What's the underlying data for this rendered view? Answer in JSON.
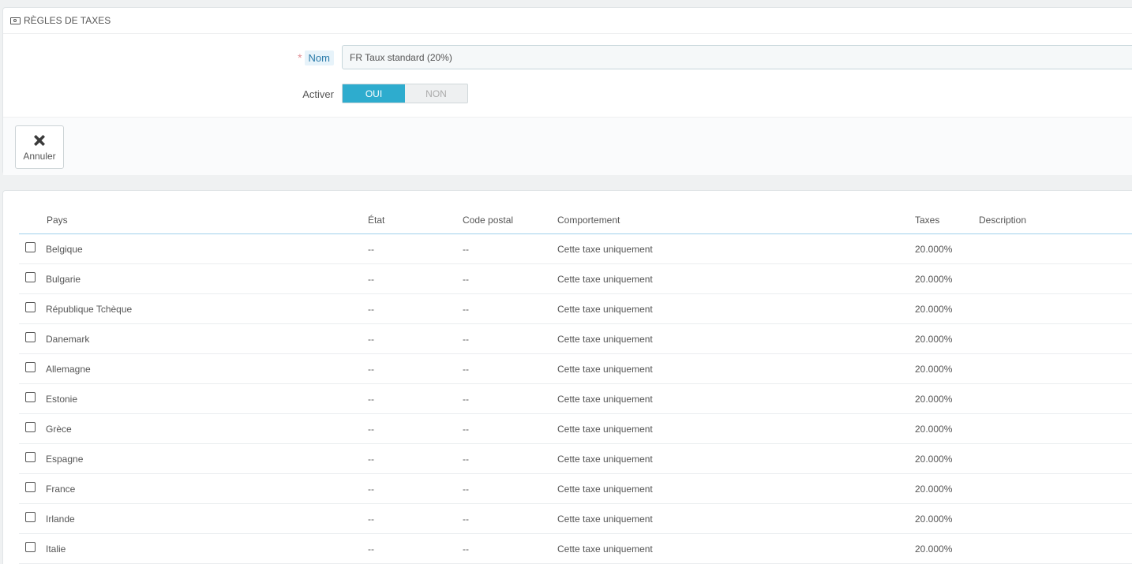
{
  "form": {
    "title": "RÈGLES DE TAXES",
    "name_label": "Nom",
    "name_required_mark": "*",
    "name_value": "FR Taux standard (20%)",
    "enable_label": "Activer",
    "switch_on": "OUI",
    "switch_off": "NON",
    "switch_state": "OUI",
    "cancel_label": "Annuler"
  },
  "table": {
    "headers": {
      "pays": "Pays",
      "etat": "État",
      "code_postal": "Code postal",
      "comportement": "Comportement",
      "taxes": "Taxes",
      "description": "Description"
    },
    "rows": [
      {
        "pays": "Belgique",
        "etat": "--",
        "code_postal": "--",
        "comportement": "Cette taxe uniquement",
        "taxes": "20.000%",
        "description": ""
      },
      {
        "pays": "Bulgarie",
        "etat": "--",
        "code_postal": "--",
        "comportement": "Cette taxe uniquement",
        "taxes": "20.000%",
        "description": ""
      },
      {
        "pays": "République Tchèque",
        "etat": "--",
        "code_postal": "--",
        "comportement": "Cette taxe uniquement",
        "taxes": "20.000%",
        "description": ""
      },
      {
        "pays": "Danemark",
        "etat": "--",
        "code_postal": "--",
        "comportement": "Cette taxe uniquement",
        "taxes": "20.000%",
        "description": ""
      },
      {
        "pays": "Allemagne",
        "etat": "--",
        "code_postal": "--",
        "comportement": "Cette taxe uniquement",
        "taxes": "20.000%",
        "description": ""
      },
      {
        "pays": "Estonie",
        "etat": "--",
        "code_postal": "--",
        "comportement": "Cette taxe uniquement",
        "taxes": "20.000%",
        "description": ""
      },
      {
        "pays": "Grèce",
        "etat": "--",
        "code_postal": "--",
        "comportement": "Cette taxe uniquement",
        "taxes": "20.000%",
        "description": ""
      },
      {
        "pays": "Espagne",
        "etat": "--",
        "code_postal": "--",
        "comportement": "Cette taxe uniquement",
        "taxes": "20.000%",
        "description": ""
      },
      {
        "pays": "France",
        "etat": "--",
        "code_postal": "--",
        "comportement": "Cette taxe uniquement",
        "taxes": "20.000%",
        "description": ""
      },
      {
        "pays": "Irlande",
        "etat": "--",
        "code_postal": "--",
        "comportement": "Cette taxe uniquement",
        "taxes": "20.000%",
        "description": ""
      },
      {
        "pays": "Italie",
        "etat": "--",
        "code_postal": "--",
        "comportement": "Cette taxe uniquement",
        "taxes": "20.000%",
        "description": ""
      }
    ]
  },
  "colors": {
    "accent": "#2eacce",
    "required": "#e08f95",
    "page_background": "#eff1f2"
  },
  "icons": {
    "heading": "money-icon",
    "cancel": "close-icon"
  }
}
